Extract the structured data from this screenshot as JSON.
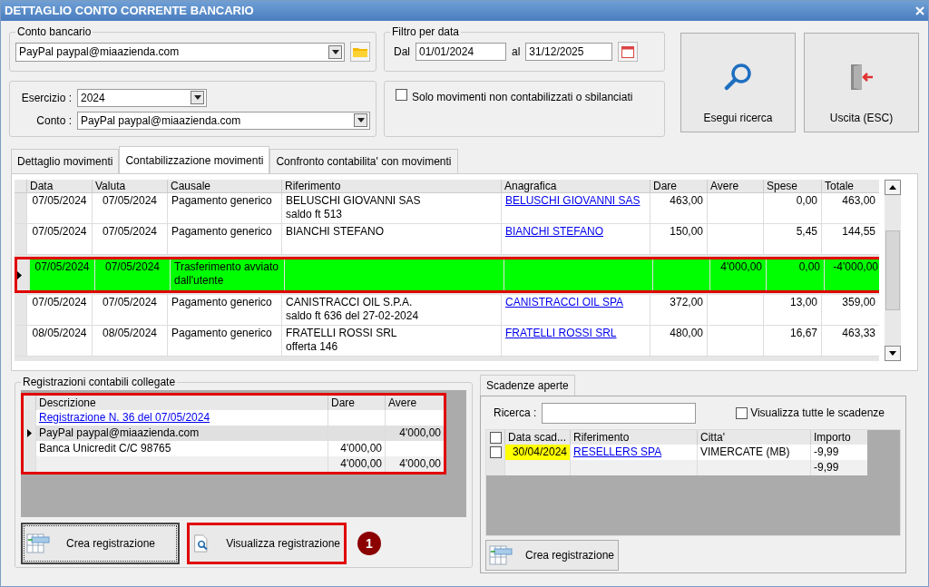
{
  "window": {
    "title": "DETTAGLIO CONTO CORRENTE BANCARIO"
  },
  "conto_bancario": {
    "legend": "Conto bancario",
    "value": "PayPal paypal@miaazienda.com"
  },
  "filtro": {
    "legend": "Filtro per data",
    "dal_label": "Dal",
    "dal": "01/01/2024",
    "al_label": "al",
    "al": "31/12/2025"
  },
  "esercizio": {
    "label": "Esercizio :",
    "value": "2024"
  },
  "conto": {
    "label": "Conto :",
    "value": "PayPal paypal@miaazienda.com"
  },
  "solo_movimenti": {
    "label": "Solo movimenti non contabilizzati o sbilanciati",
    "checked": false
  },
  "actions": [
    {
      "kind": "search",
      "label": "Esegui ricerca"
    },
    {
      "kind": "exit",
      "label": "Uscita (ESC)"
    }
  ],
  "tabs": [
    {
      "label": "Dettaglio movimenti",
      "selected": false
    },
    {
      "label": "Contabilizzazione movimenti",
      "selected": true
    },
    {
      "label": "Confronto contabilita' con movimenti",
      "selected": false
    }
  ],
  "movements": {
    "columns": [
      "Data",
      "Valuta",
      "Causale",
      "Riferimento",
      "Anagrafica",
      "Dare",
      "Avere",
      "Spese",
      "Totale"
    ],
    "rows": [
      {
        "data": "07/05/2024",
        "valuta": "07/05/2024",
        "causale": [
          "Pagamento generico"
        ],
        "riferimento": [
          "BELUSCHI GIOVANNI SAS",
          "saldo ft 513"
        ],
        "anagrafica": "BELUSCHI GIOVANNI SAS",
        "dare": "463,00",
        "avere": "",
        "spese": "0,00",
        "totale": "463,00",
        "selected": false,
        "highlighted": false
      },
      {
        "data": "07/05/2024",
        "valuta": "07/05/2024",
        "causale": [
          "Pagamento generico"
        ],
        "riferimento": [
          "BIANCHI STEFANO"
        ],
        "anagrafica": "BIANCHI STEFANO",
        "dare": "150,00",
        "avere": "",
        "spese": "5,45",
        "totale": "144,55",
        "selected": false,
        "highlighted": false
      },
      {
        "data": "07/05/2024",
        "valuta": "07/05/2024",
        "causale": [
          "Trasferimento avviato",
          "dall'utente"
        ],
        "riferimento": [],
        "anagrafica": "",
        "dare": "",
        "avere": "4'000,00",
        "spese": "0,00",
        "totale": "-4'000,00",
        "selected": true,
        "highlighted": true
      },
      {
        "data": "07/05/2024",
        "valuta": "07/05/2024",
        "causale": [
          "Pagamento generico"
        ],
        "riferimento": [
          "CANISTRACCI OIL S.P.A.",
          "saldo ft 636 del 27-02-2024"
        ],
        "anagrafica": "CANISTRACCI OIL SPA",
        "dare": "372,00",
        "avere": "",
        "spese": "13,00",
        "totale": "359,00",
        "selected": false,
        "highlighted": false
      },
      {
        "data": "08/05/2024",
        "valuta": "08/05/2024",
        "causale": [
          "Pagamento generico"
        ],
        "riferimento": [
          "FRATELLI ROSSI SRL",
          "offerta 146"
        ],
        "anagrafica": "FRATELLI ROSSI SRL",
        "dare": "480,00",
        "avere": "",
        "spese": "16,67",
        "totale": "463,33",
        "selected": false,
        "highlighted": false
      }
    ]
  },
  "registrazioni": {
    "legend": "Registrazioni contabili collegate",
    "highlighted": true,
    "columns": [
      "Descrizione",
      "Dare",
      "Avere"
    ],
    "rows": [
      {
        "kind": "link",
        "descrizione": "Registrazione N. 36 del 07/05/2024",
        "dare": "",
        "avere": "",
        "selected": false
      },
      {
        "kind": "entry",
        "descrizione": "PayPal paypal@miaazienda.com",
        "dare": "",
        "avere": "4'000,00",
        "selected": true
      },
      {
        "kind": "entry",
        "descrizione": "Banca Unicredit C/C 98765",
        "dare": "4'000,00",
        "avere": "",
        "selected": false
      },
      {
        "kind": "total",
        "descrizione": "",
        "dare": "4'000,00",
        "avere": "4'000,00",
        "selected": false
      }
    ]
  },
  "registrazioni_buttons": [
    {
      "label": "Crea registrazione",
      "kind": "create",
      "highlighted": false,
      "focused": true
    },
    {
      "label": "Visualizza registrazione",
      "kind": "view",
      "highlighted": true,
      "focused": false
    }
  ],
  "callout": "1",
  "scadenze": {
    "tab": "Scadenze aperte",
    "ricerca_label": "Ricerca :",
    "all_checked": false,
    "tutte": {
      "label": "Visualizza tutte le scadenze",
      "checked": false
    },
    "columns": [
      "Data scad...",
      "Riferimento",
      "Citta'",
      "Importo"
    ],
    "rows": [
      {
        "kind": "item",
        "checked": false,
        "data": "30/04/2024",
        "riferimento": "RESELLERS SPA",
        "citta": "VIMERCATE (MB)",
        "importo": "-9,99"
      },
      {
        "kind": "total",
        "data": "",
        "riferimento": "",
        "citta": "",
        "importo": "-9,99"
      }
    ],
    "button": "Crea registrazione"
  }
}
